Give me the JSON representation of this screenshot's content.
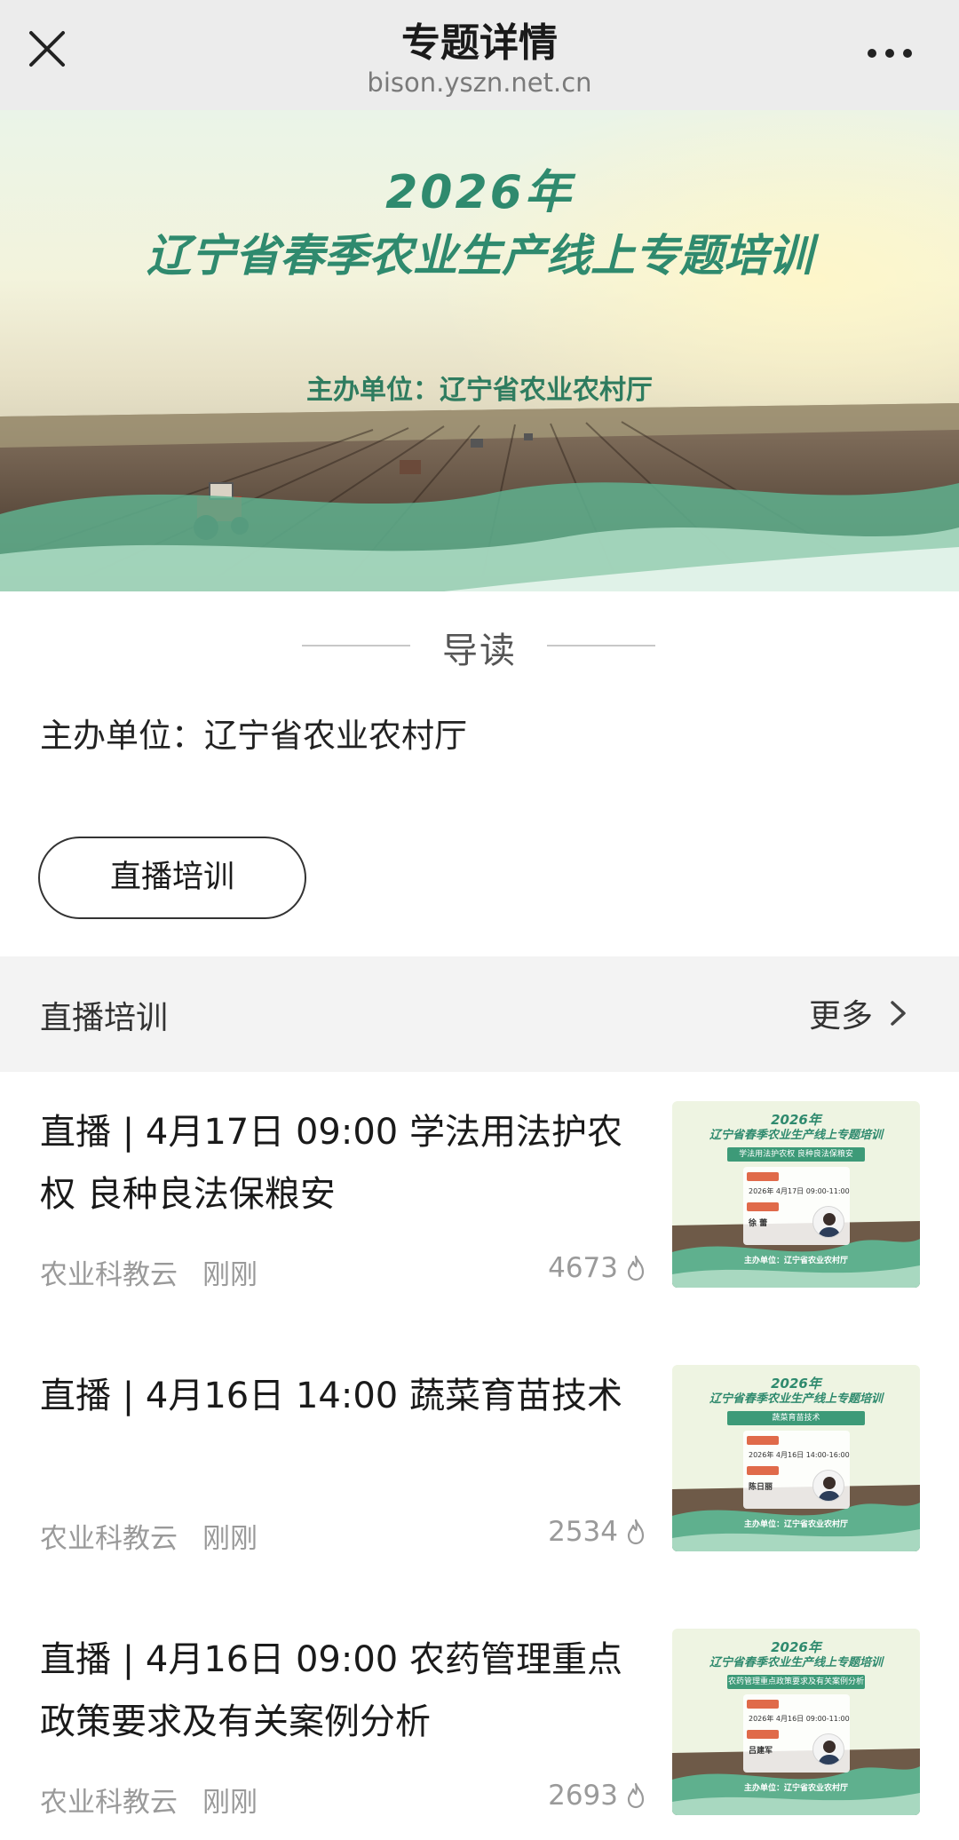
{
  "nav": {
    "title": "专题详情",
    "url": "bison.yszn.net.cn",
    "close_icon": "close-icon",
    "more_icon": "more-dots-icon"
  },
  "banner": {
    "year": "2026年",
    "title": "辽宁省春季农业生产线上专题培训",
    "organizer": "主办单位：辽宁省农业农村厅"
  },
  "intro": {
    "label": "导读",
    "organizer_text": "主办单位：辽宁省农业农村厅",
    "tag_button": "直播培训"
  },
  "section": {
    "title": "直播培训",
    "more_label": "更多"
  },
  "articles": [
    {
      "title": "直播 | 4月17日 09:00 学法用法护农权 良种良法保粮安",
      "source": "农业科教云",
      "time": "刚刚",
      "views": "4673",
      "thumb": {
        "year": "2026年",
        "title": "辽宁省春季农业生产线上专题培训",
        "topic": "学法用法护农权 良种良法保粮安",
        "time": "2026年 4月17日 09:00-11:00",
        "speaker": "徐 蕾",
        "host": "主办单位：辽宁省农业农村厅"
      }
    },
    {
      "title": "直播 | 4月16日 14:00 蔬菜育苗技术",
      "source": "农业科教云",
      "time": "刚刚",
      "views": "2534",
      "thumb": {
        "year": "2026年",
        "title": "辽宁省春季农业生产线上专题培训",
        "topic": "蔬菜育苗技术",
        "time": "2026年 4月16日 14:00-16:00",
        "speaker": "陈日丽",
        "host": "主办单位：辽宁省农业农村厅"
      }
    },
    {
      "title": "直播 | 4月16日 09:00 农药管理重点政策要求及有关案例分析",
      "source": "农业科教云",
      "time": "刚刚",
      "views": "2693",
      "thumb": {
        "year": "2026年",
        "title": "辽宁省春季农业生产线上专题培训",
        "topic": "农药管理重点政策要求及有关案例分析",
        "time": "2026年 4月16日 09:00-11:00",
        "speaker": "吕建军",
        "host": "主办单位：辽宁省农业农村厅"
      }
    }
  ],
  "colors": {
    "accent_green": "#2f8a6e",
    "nav_bg": "#ececec",
    "section_bg": "#f3f3f3"
  }
}
